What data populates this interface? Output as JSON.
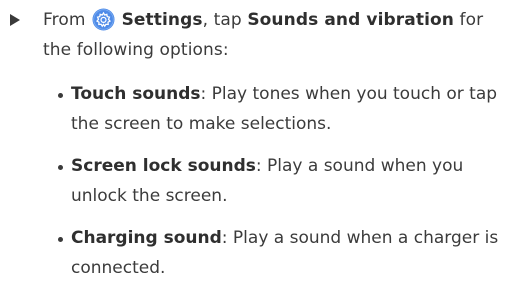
{
  "step": {
    "prefix": "From",
    "icon": "settings-gear-icon",
    "settings_label": "Settings",
    "middle": ", tap",
    "sounds_label": "Sounds and vibration",
    "suffix": "for the following options:"
  },
  "options": [
    {
      "name": "Touch sounds",
      "description": ": Play tones when you touch or tap the screen to make selections."
    },
    {
      "name": "Screen lock sounds",
      "description": ": Play a sound when you unlock the screen."
    },
    {
      "name": "Charging sound",
      "description": ": Play a sound when a charger is connected."
    }
  ],
  "colors": {
    "icon_background": "#4f8be8",
    "text": "#3b3b3b"
  }
}
